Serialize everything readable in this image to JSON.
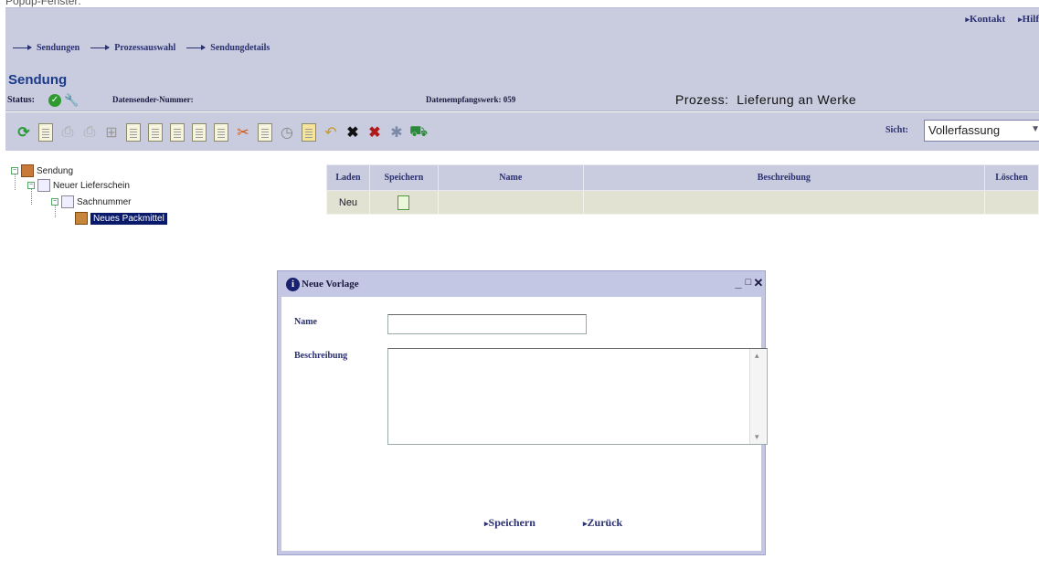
{
  "header": {
    "top_links": [
      "Kontakt",
      "Hilf"
    ],
    "breadcrumb": [
      "Sendungen",
      "Prozessauswahl",
      "Sendungdetails"
    ],
    "top_cut_text": "Popup-Fenster:"
  },
  "page": {
    "title": "Sendung"
  },
  "status": {
    "status_label": "Status:",
    "sender_label": "Datensender-Nummer:",
    "receiver_label": "Datenempfangswerk: 059",
    "process_label": "Prozess:",
    "process_value": "Lieferung an Werke"
  },
  "toolbar": {
    "view_label": "Sicht:",
    "view_value": "Vollerfassung",
    "icons": [
      "refresh-icon",
      "new-doc-icon",
      "print-preview-icon",
      "print-icon",
      "grid-icon",
      "doc-icon",
      "doc-icon-2",
      "doc-icon-3",
      "doc-icon-4",
      "cut-icon",
      "copy-icon",
      "clock-icon",
      "paste-icon",
      "undo-icon",
      "delete-icon",
      "delete-all-icon",
      "bug-icon",
      "truck-icon"
    ]
  },
  "tree": {
    "nodes": [
      {
        "label": "Sendung",
        "icon": "shipment-icon"
      },
      {
        "label": "Neuer Lieferschein",
        "icon": "delivery-note-icon"
      },
      {
        "label": "Sachnummer",
        "icon": "part-number-icon"
      },
      {
        "label": "Neues Packmittel",
        "icon": "package-icon"
      }
    ]
  },
  "table": {
    "columns": [
      "Laden",
      "Speichern",
      "Name",
      "Beschreibung",
      "Löschen"
    ],
    "rows": [
      {
        "laden": "Neu",
        "speichern_icon": "save-doc-icon",
        "name": "",
        "beschreibung": ""
      }
    ]
  },
  "dialog": {
    "title": "Neue Vorlage",
    "name_label": "Name",
    "name_value": "",
    "description_label": "Beschreibung",
    "description_value": "",
    "save_label": "Speichern",
    "back_label": "Zurück",
    "controls": [
      "_",
      "□",
      "✕"
    ]
  },
  "colors": {
    "header_bg": "#c9cbde",
    "dialog_bg": "#c4c7e4",
    "title": "#1a3a8a",
    "link": "#2a3070",
    "selection": "#0a1a6a"
  }
}
